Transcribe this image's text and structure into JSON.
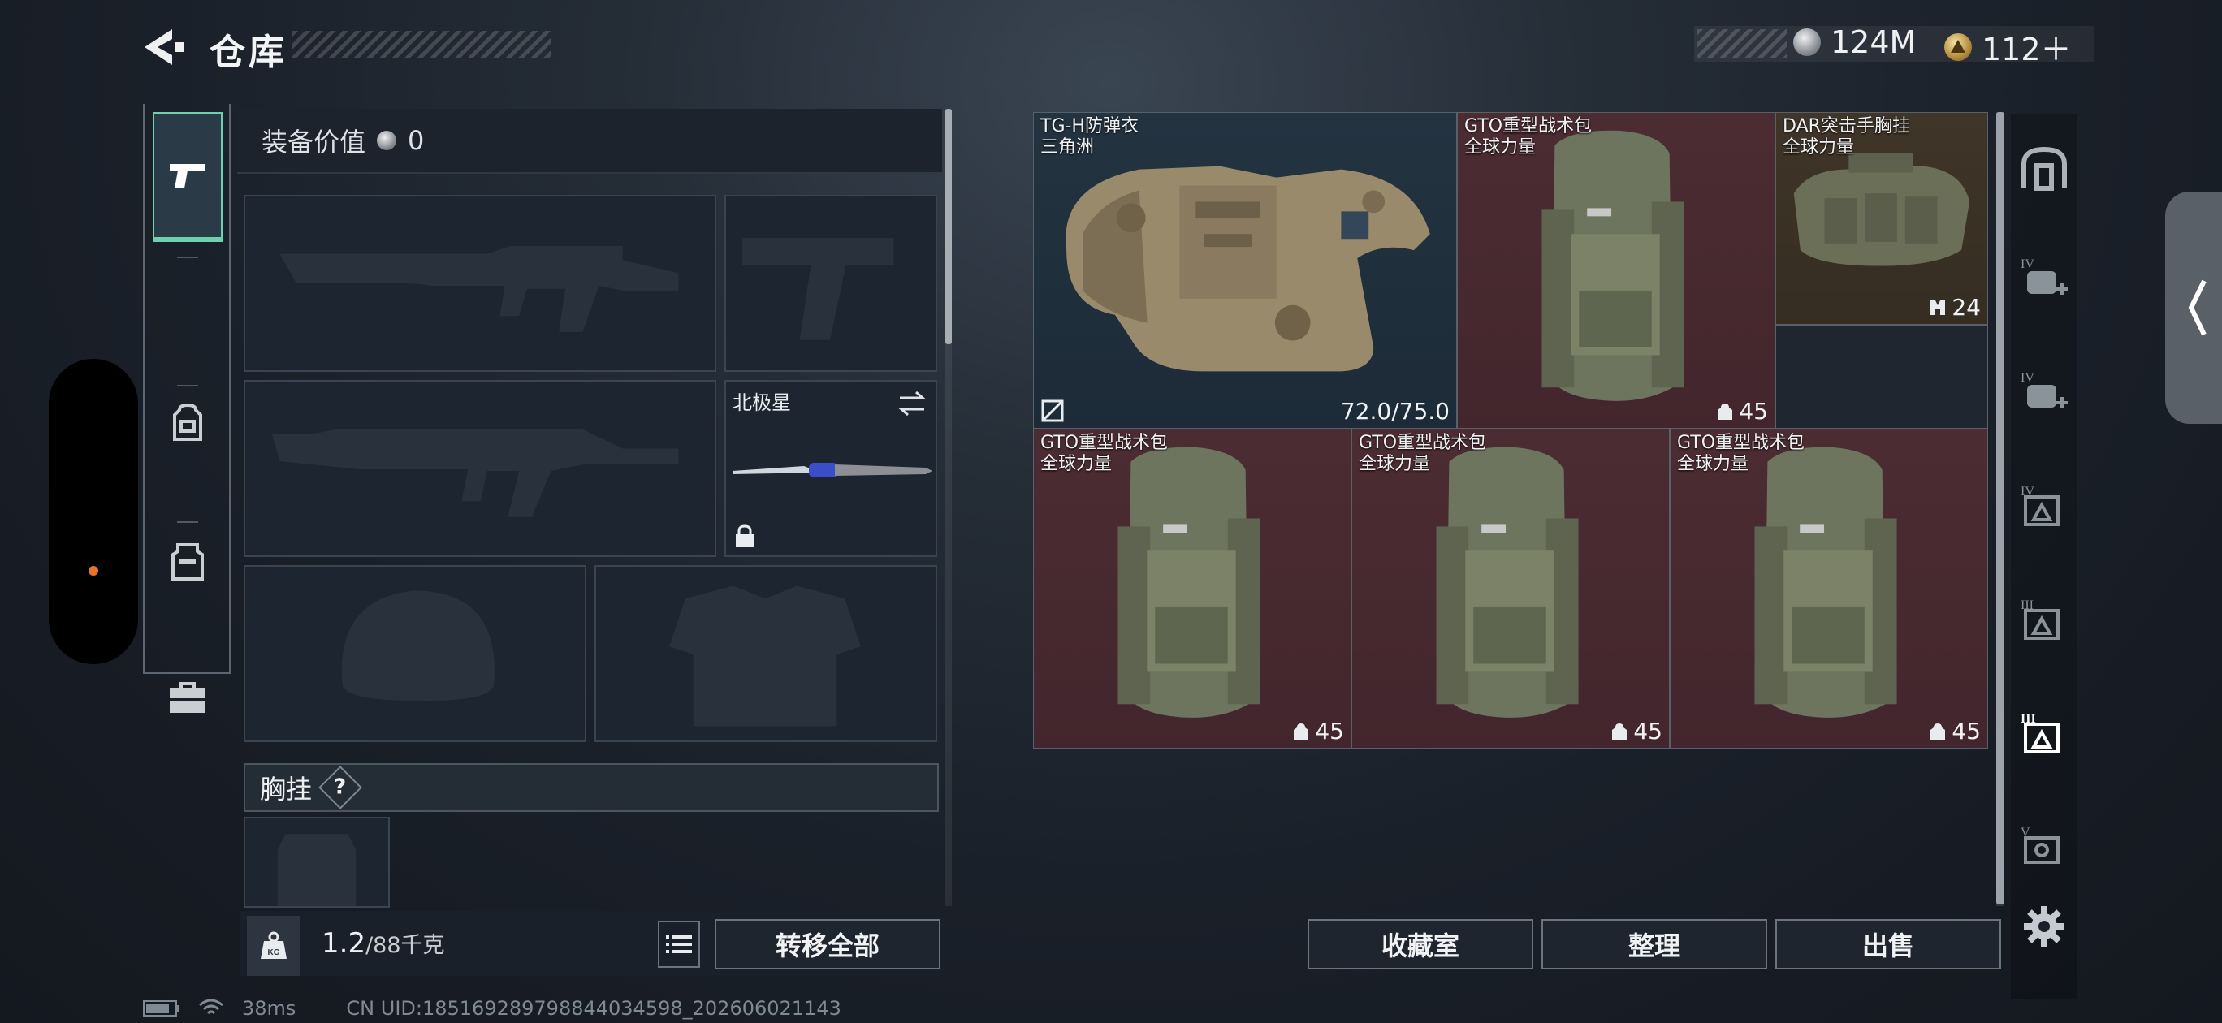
{
  "header": {
    "title": "仓库"
  },
  "currency": {
    "silver": "124M",
    "gold": "112＋"
  },
  "equipment": {
    "value_label": "装备价值",
    "value": "0",
    "secondary_name": "北极星",
    "chest_label": "胸挂",
    "chest_help": "?",
    "weight": "1.2",
    "weight_unit": "/88千克",
    "transfer_all": "转移全部"
  },
  "nav": [
    "weapons",
    "backpack-tab",
    "rig-tab",
    "case-tab"
  ],
  "storage": {
    "items": [
      {
        "name": "TG-H防弹衣",
        "sub": "三角洲",
        "durability": "72.0/75.0",
        "color": "blue",
        "kind": "vest"
      },
      {
        "name": "GTO重型战术包",
        "sub": "全球力量",
        "count": "45",
        "color": "red",
        "kind": "bag"
      },
      {
        "name": "DAR突击手胸挂",
        "sub": "全球力量",
        "count": "24",
        "color": "brown",
        "kind": "rig"
      },
      {
        "name": "GTO重型战术包",
        "sub": "全球力量",
        "count": "45",
        "color": "red",
        "kind": "bag"
      },
      {
        "name": "GTO重型战术包",
        "sub": "全球力量",
        "count": "45",
        "color": "red",
        "kind": "bag"
      },
      {
        "name": "GTO重型战术包",
        "sub": "全球力量",
        "count": "45",
        "color": "red",
        "kind": "bag"
      }
    ],
    "buttons": {
      "collection": "收藏室",
      "sort": "整理",
      "sell": "出售"
    }
  },
  "side_tools": [
    "storage-home",
    "tier-IV-add-1",
    "tier-IV-add-2",
    "tier-IV-filter",
    "tier-III-filter",
    "tier-III-filter-active",
    "tier-V-filter",
    "settings"
  ],
  "status": {
    "ping": "38ms",
    "uid": "CN UID:185169289798844034598_202606021143"
  },
  "colors": {
    "accent": "#6fd0b0",
    "red_cell": "#4b2c32",
    "blue_cell": "#233340",
    "brown_cell": "#3f3528"
  }
}
